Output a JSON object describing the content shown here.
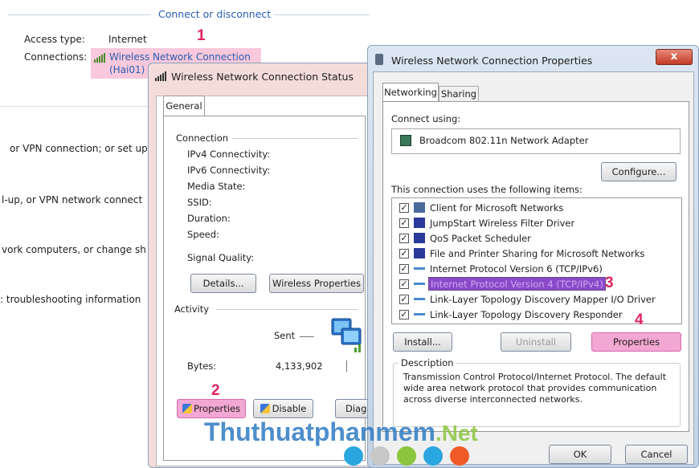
{
  "bg": {
    "section_title": "Connect or disconnect",
    "access_type_label": "Access type:",
    "access_type_value": "Internet",
    "connections_label": "Connections:",
    "connection_name_line1": "Wireless Network Connection",
    "connection_name_line2": "(Hai01)",
    "rows": [
      "or VPN connection; or set up",
      "l-up, or VPN network connect",
      "vork computers, or change sh",
      ": troubleshooting information"
    ]
  },
  "status": {
    "title": "Wireless Network Connection Status",
    "tab": "General",
    "connection_group": "Connection",
    "fields": [
      "IPv4 Connectivity:",
      "IPv6 Connectivity:",
      "Media State:",
      "SSID:",
      "Duration:",
      "Speed:"
    ],
    "signal_quality": "Signal Quality:",
    "details_button": "Details...",
    "wireless_props_button": "Wireless Properties",
    "activity_group": "Activity",
    "sent_label": "Sent",
    "bytes_label": "Bytes:",
    "bytes_value": "4,133,902",
    "properties_button": "Properties",
    "disable_button": "Disable",
    "diagnose_button": "Diag"
  },
  "props": {
    "title": "Wireless Network Connection Properties",
    "tabs": [
      "Networking",
      "Sharing"
    ],
    "connect_using_label": "Connect using:",
    "adapter": "Broadcom 802.11n Network Adapter",
    "configure_button": "Configure...",
    "items_label": "This connection uses the following items:",
    "items": [
      "Client for Microsoft Networks",
      "JumpStart Wireless Filter Driver",
      "QoS Packet Scheduler",
      "File and Printer Sharing for Microsoft Networks",
      "Internet Protocol Version 6 (TCP/IPv6)",
      "Internet Protocol Version 4 (TCP/IPv4)",
      "Link-Layer Topology Discovery Mapper I/O Driver",
      "Link-Layer Topology Discovery Responder"
    ],
    "install_button": "Install...",
    "uninstall_button": "Uninstall",
    "properties_button": "Properties",
    "description_group": "Description",
    "description": "Transmission Control Protocol/Internet Protocol. The default wide area network protocol that provides communication across diverse interconnected networks.",
    "ok_button": "OK",
    "cancel_button": "Cancel",
    "close_glyph": "x"
  },
  "steps": [
    "1",
    "2",
    "3",
    "4"
  ],
  "watermark": "Thuthuatphanmem",
  "watermark_suffix": ".Net",
  "dot_colors": [
    "#2aa6e0",
    "#c8c8c8",
    "#8cc63f",
    "#2aa6e0",
    "#f05a28"
  ]
}
